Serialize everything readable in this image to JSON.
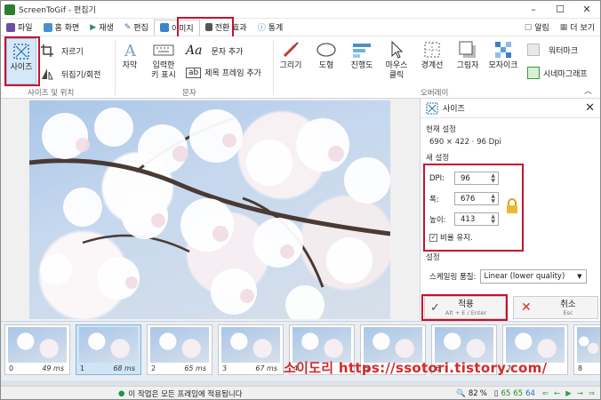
{
  "window": {
    "title": "ScreenToGif - 편집기",
    "min": "–",
    "max": "☐",
    "close": "✕"
  },
  "menu": {
    "tabs": [
      {
        "label": "파일",
        "icon": "save-icon"
      },
      {
        "label": "홈 화면",
        "icon": "home-icon"
      },
      {
        "label": "재생",
        "icon": "play-icon"
      },
      {
        "label": "편집",
        "icon": "pencil-icon"
      },
      {
        "label": "이미지",
        "icon": "image-icon",
        "active": true
      },
      {
        "label": "전환 효과",
        "icon": "transition-icon"
      },
      {
        "label": "통계",
        "icon": "info-icon"
      }
    ],
    "right": [
      {
        "label": "알림",
        "icon": "notification-icon"
      },
      {
        "label": "더 보기",
        "icon": "more-icon"
      }
    ]
  },
  "ribbon": {
    "size_pos": {
      "resize": "사이즈",
      "crop": "자르기",
      "flip": "뒤집기/회전",
      "group": "사이즈 및 위치"
    },
    "text": {
      "caption": "자막",
      "key_strokes_1": "입력한",
      "key_strokes_2": "키 표시",
      "free_text": "문자 추가",
      "title_frame": "제목 프레임 추가",
      "group": "문자"
    },
    "overlay": {
      "free_drawing": "그리기",
      "shapes": "도형",
      "progress": "진행도",
      "mouse_1": "마우스",
      "mouse_2": "클릭",
      "border": "경계선",
      "shadow": "그림자",
      "obfuscate": "모자이크",
      "watermark": "워터마크",
      "cinemagraph": "시네마그래프",
      "group": "오버레이"
    }
  },
  "panel": {
    "title": "사이즈",
    "current_label": "현재 설정",
    "current_info": "690 × 422 · 96 Dpi",
    "new_label": "새 설정",
    "dpi_label": "DPI:",
    "dpi_value": "96",
    "width_label": "폭:",
    "width_value": "676",
    "height_label": "높이:",
    "height_value": "413",
    "keep_ratio": "비율 유지.",
    "settings_label": "설정",
    "scaling_label": "스케일링 품질:",
    "scaling_value": "Linear (lower quality)",
    "apply": "적용",
    "apply_hint": "Alt + E / Enter",
    "cancel": "취소",
    "cancel_hint": "Esc"
  },
  "frames": [
    {
      "index": "0",
      "duration": "49 ms"
    },
    {
      "index": "1",
      "duration": "68 ms",
      "selected": true
    },
    {
      "index": "2",
      "duration": "65 ms"
    },
    {
      "index": "3",
      "duration": "67 ms"
    },
    {
      "index": "4",
      "duration": ""
    },
    {
      "index": "5",
      "duration": ""
    },
    {
      "index": "6",
      "duration": ""
    },
    {
      "index": "7",
      "duration": ""
    },
    {
      "index": "8",
      "duration": ""
    }
  ],
  "watermark_text": "소이도리 https://ssotori.tistory.com/",
  "status": {
    "message": "이 작업은 모든 프레임에 적용됩니다",
    "zoom": "82",
    "zoom_unit": "%",
    "count_total": "65",
    "count_selected": "65",
    "count_other": "64"
  },
  "colors": {
    "highlight_red": "#c8102e",
    "accent_blue": "#1f6fb5"
  }
}
